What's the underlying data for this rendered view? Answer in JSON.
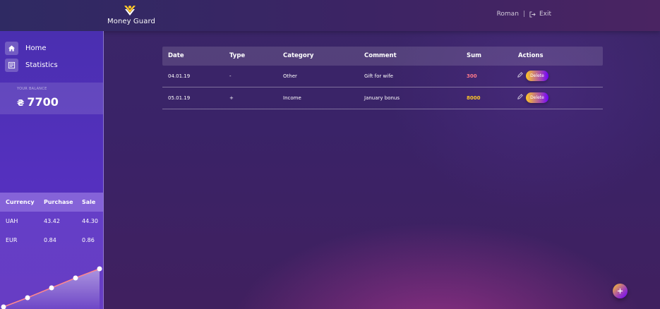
{
  "header": {
    "logo_text": "Money Guard",
    "logo_icon": "money-guard-logo-icon",
    "user_name": "Roman",
    "separator": "|",
    "exit_label": "Exit",
    "exit_icon": "exit-icon"
  },
  "sidebar": {
    "nav": [
      {
        "label": "Home",
        "icon": "home-icon"
      },
      {
        "label": "Statistics",
        "icon": "statistics-icon"
      }
    ],
    "balance": {
      "title": "YOUR BALANCE",
      "currency_symbol": "₴",
      "value": "7700"
    },
    "rates": {
      "headers": [
        "Currency",
        "Purchase",
        "Sale"
      ],
      "rows": [
        {
          "currency": "UAH",
          "purchase": "43.42",
          "sale": "44.30"
        },
        {
          "currency": "EUR",
          "purchase": "0.84",
          "sale": "0.86"
        }
      ]
    }
  },
  "transactions": {
    "headers": [
      "Date",
      "Type",
      "Category",
      "Comment",
      "Sum",
      "Actions"
    ],
    "rows": [
      {
        "date": "04.01.19",
        "type": "-",
        "category": "Other",
        "comment": "Gift for wife",
        "sum": "300",
        "delete_label": "Delete"
      },
      {
        "date": "05.01.19",
        "type": "+",
        "category": "Income",
        "comment": "January bonus",
        "sum": "8000",
        "delete_label": "Delete"
      }
    ]
  },
  "colors": {
    "expense": "#ff7a8a",
    "income": "#ffc727",
    "accent": "#ffc727"
  }
}
